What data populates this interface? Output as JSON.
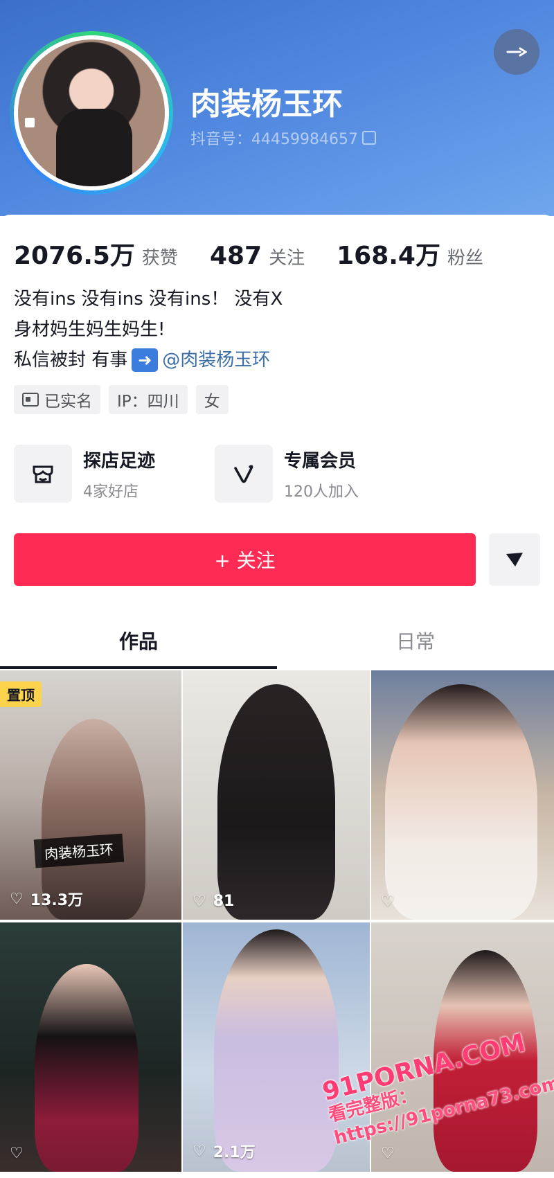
{
  "profile": {
    "nickname": "肉装杨玉环",
    "douyin_id": "抖音号：44459984657"
  },
  "stats": [
    {
      "value": "2076.5万",
      "label": "获赞"
    },
    {
      "value": "487",
      "label": "关注"
    },
    {
      "value": "168.4万",
      "label": "粉丝"
    }
  ],
  "bio": {
    "line1": "没有ins 没有ins 没有ins！ 没有X",
    "line2": "身材妈生妈生妈生!",
    "line3_prefix": "私信被封 有事",
    "mention": "@肉装杨玉环"
  },
  "tags": {
    "verified": "已实名",
    "ip": "IP：四川",
    "gender": "女"
  },
  "services": [
    {
      "title": "探店足迹",
      "sub": "4家好店"
    },
    {
      "title": "专属会员",
      "sub": "120人加入"
    }
  ],
  "actions": {
    "follow": "+ 关注"
  },
  "tabs": [
    {
      "label": "作品"
    },
    {
      "label": "日常"
    }
  ],
  "grid": [
    {
      "likes": "13.3万",
      "badge": "置顶",
      "caption": "肉装杨玉环"
    },
    {
      "likes": "81"
    },
    {
      "likes": ""
    },
    {
      "likes": ""
    },
    {
      "likes": "2.1万"
    },
    {
      "likes": ""
    }
  ],
  "watermark": {
    "line1": "91PORNA.COM",
    "line2": "看完整版：https://91porna73.com"
  },
  "colors": {
    "accent": "#fe2c55",
    "header": "#4f86de",
    "mention": "#3b6ea8"
  }
}
